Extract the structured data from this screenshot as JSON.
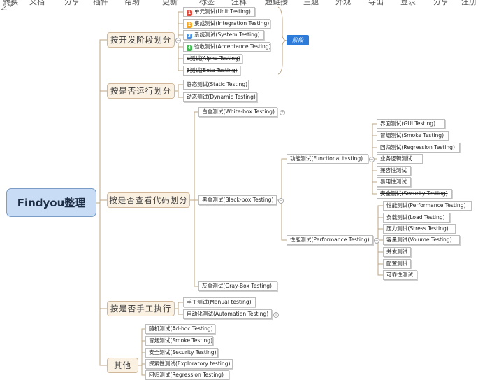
{
  "top_menu": [
    "转换",
    "文档",
    "分享",
    "插件",
    "帮助",
    "更新",
    "标签",
    "注释",
    "超链接",
    "主题",
    "外观",
    "导出",
    "登录",
    "分享",
    "注册"
  ],
  "corner_text": "之了",
  "root": {
    "label": "Findyou整理"
  },
  "branches": [
    {
      "label": "按开发阶段划分",
      "children": [
        {
          "label": "单元测试(Unit Testing)",
          "badge": "1",
          "badge_color": "#e04b3c"
        },
        {
          "label": "集成测试(Integration Testing)",
          "badge": "2",
          "badge_color": "#f5a623"
        },
        {
          "label": "系统测试(System Testing)",
          "badge": "3",
          "badge_color": "#4a90e2"
        },
        {
          "label": "验收测试(Acceptance Testing)",
          "badge": "4",
          "badge_color": "#3fb950"
        },
        {
          "label": "α测试(Alpha Testing)",
          "strike": true
        },
        {
          "label": "β测试(Beta Testing)",
          "strike": true
        }
      ],
      "annotation": "阶段"
    },
    {
      "label": "按是否运行划分",
      "children": [
        {
          "label": "静态测试(Static Testing)"
        },
        {
          "label": "动态测试(Dynamic Testing)"
        }
      ]
    },
    {
      "label": "按是否查看代码划分",
      "children": [
        {
          "label": "白盒测试(White-box Testing)"
        },
        {
          "label": "黑盒测试(Black-box Testing)",
          "children": [
            {
              "label": "功能测试(Functional testing)",
              "children": [
                {
                  "label": "界面测试(GUI Testing)"
                },
                {
                  "label": "冒烟测试(Smoke Testing)"
                },
                {
                  "label": "回归测试(Regression Testing)"
                },
                {
                  "label": "业务逻辑测试"
                },
                {
                  "label": "兼容性测试"
                },
                {
                  "label": "易用性测试"
                },
                {
                  "label": "安全测试(Security Testing)",
                  "strike": true
                }
              ]
            },
            {
              "label": "性能测试(Performance Testing)",
              "children": [
                {
                  "label": "性能测试(Performance Testing)"
                },
                {
                  "label": "负载测试(Load Testing)"
                },
                {
                  "label": "压力测试(Stress Testing)"
                },
                {
                  "label": "容量测试(Volume Testing)"
                },
                {
                  "label": "并发测试"
                },
                {
                  "label": "配置测试"
                },
                {
                  "label": "可靠性测试"
                }
              ]
            }
          ]
        },
        {
          "label": "灰盒测试(Gray-Box Testing)"
        }
      ]
    },
    {
      "label": "按是否手工执行",
      "children": [
        {
          "label": "手工测试(Manual testing)"
        },
        {
          "label": "自动化测试(Automation Testing)"
        }
      ]
    },
    {
      "label": "其他",
      "children": [
        {
          "label": "随机测试(Ad-hoc Testing)"
        },
        {
          "label": "冒烟测试(Smoke Testing)"
        },
        {
          "label": "安全测试(Security Testing)"
        },
        {
          "label": "探索性测试(Exploratory testing)"
        },
        {
          "label": "回归测试(Regression Testing)"
        }
      ]
    }
  ]
}
